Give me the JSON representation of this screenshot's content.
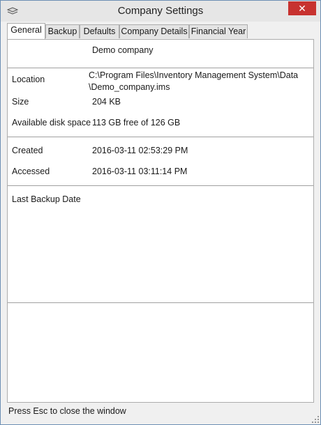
{
  "window": {
    "title": "Company Settings",
    "close_glyph": "✕",
    "app_icon": "app-logo-icon"
  },
  "tabs": [
    {
      "label": "General",
      "active": true
    },
    {
      "label": "Backup",
      "active": false
    },
    {
      "label": "Defaults",
      "active": false
    },
    {
      "label": "Company Details",
      "active": false
    },
    {
      "label": "Financial Year",
      "active": false
    }
  ],
  "general": {
    "company_name": "Demo company",
    "location_label": "Location",
    "location_line1": "C:\\Program Files\\Inventory Management System\\Data",
    "location_line2": "\\Demo_company.ims",
    "size_label": "Size",
    "size_value": "204 KB",
    "disk_label": "Available disk space",
    "disk_value": "113 GB free of 126 GB",
    "created_label": "Created",
    "created_value": "2016-03-11 02:53:29 PM",
    "accessed_label": "Accessed",
    "accessed_value": "2016-03-11 03:11:14 PM",
    "backup_label": "Last Backup Date"
  },
  "status": {
    "text": "Press Esc to close the window"
  }
}
